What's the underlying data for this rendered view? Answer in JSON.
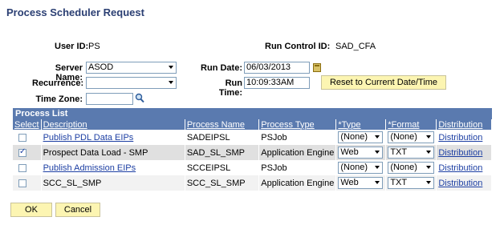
{
  "page": {
    "title": "Process Scheduler Request"
  },
  "header": {
    "user_id_label": "User ID:",
    "user_id_value": "PS",
    "run_control_label": "Run Control ID:",
    "run_control_value": "SAD_CFA"
  },
  "form": {
    "server_name_label": "Server Name:",
    "server_name_value": "ASOD",
    "recurrence_label": "Recurrence:",
    "recurrence_value": "",
    "time_zone_label": "Time Zone:",
    "time_zone_value": "",
    "run_date_label": "Run Date:",
    "run_date_value": "06/03/2013",
    "run_time_label": "Run Time:",
    "run_time_value": "10:09:33AM",
    "reset_button_label": "Reset to Current Date/Time"
  },
  "process_list": {
    "title": "Process List",
    "columns": {
      "select": "Select",
      "description": "Description",
      "process_name": "Process Name",
      "process_type": "Process Type",
      "type": "*Type",
      "format": "*Format",
      "distribution": "Distribution"
    },
    "rows": [
      {
        "selected": false,
        "description": "Publish PDL Data EIPs",
        "description_is_link": true,
        "process_name": "SADEIPSL",
        "process_type": "PSJob",
        "type": "(None)",
        "format": "(None)",
        "distribution": "Distribution"
      },
      {
        "selected": true,
        "description": "Prospect Data Load - SMP",
        "description_is_link": false,
        "process_name": "SAD_SL_SMP",
        "process_type": "Application Engine",
        "type": "Web",
        "format": "TXT",
        "distribution": "Distribution"
      },
      {
        "selected": false,
        "description": "Publish Admission EIPs",
        "description_is_link": true,
        "process_name": "SCCEIPSL",
        "process_type": "PSJob",
        "type": "(None)",
        "format": "(None)",
        "distribution": "Distribution"
      },
      {
        "selected": false,
        "description": "SCC_SL_SMP",
        "description_is_link": false,
        "process_name": "SCC_SL_SMP",
        "process_type": "Application Engine",
        "type": "Web",
        "format": "TXT",
        "distribution": "Distribution"
      }
    ]
  },
  "actions": {
    "ok_label": "OK",
    "cancel_label": "Cancel"
  },
  "colors": {
    "title": "#2b3f73",
    "grid_header": "#5a7aaf",
    "link": "#1d3fa3",
    "button_yellow": "#fcf5b2"
  },
  "icons": {
    "calendar": "calendar-icon",
    "lookup": "search-icon"
  }
}
